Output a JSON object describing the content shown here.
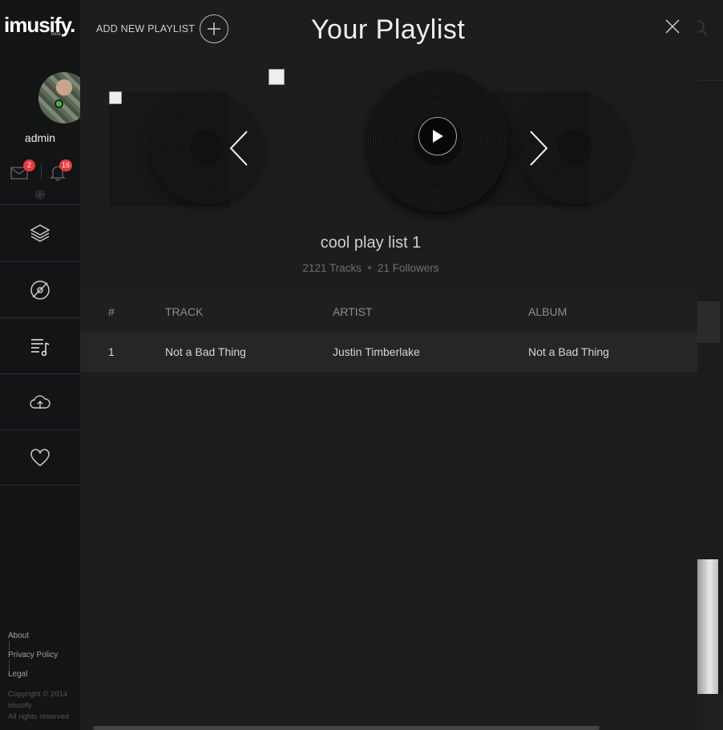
{
  "app": {
    "logo": "imusify.",
    "logo_sub": "beta"
  },
  "sidebar": {
    "username": "admin",
    "messages_count": "2",
    "notifications_count": "16",
    "nav": [
      {
        "name": "stack-icon"
      },
      {
        "name": "disc-icon"
      },
      {
        "name": "playlist-icon"
      },
      {
        "name": "cloud-upload-icon"
      },
      {
        "name": "heart-icon"
      }
    ],
    "footer": {
      "about": "About",
      "privacy": "Privacy Policy",
      "legal": "Legal",
      "copyright_line1": "Copyright © 2014",
      "copyright_line2": "imusify",
      "copyright_line3": "All rights reserved"
    }
  },
  "modal": {
    "add_playlist_label": "ADD NEW PLAYLIST",
    "title": "Your Playlist",
    "playlist_name": "cool play list 1",
    "tracks": "2121 Tracks",
    "followers": "21 Followers",
    "columns": {
      "num": "#",
      "track": "TRACK",
      "artist": "ARTIST",
      "album": "ALBUM"
    },
    "rows": [
      {
        "num": "1",
        "track": "Not a Bad Thing",
        "artist": "Justin Timberlake",
        "album": "Not a Bad Thing"
      }
    ]
  },
  "colors": {
    "accent_badge": "#e8383d",
    "online": "#3bbd3b",
    "background": "#1b1c1e"
  }
}
